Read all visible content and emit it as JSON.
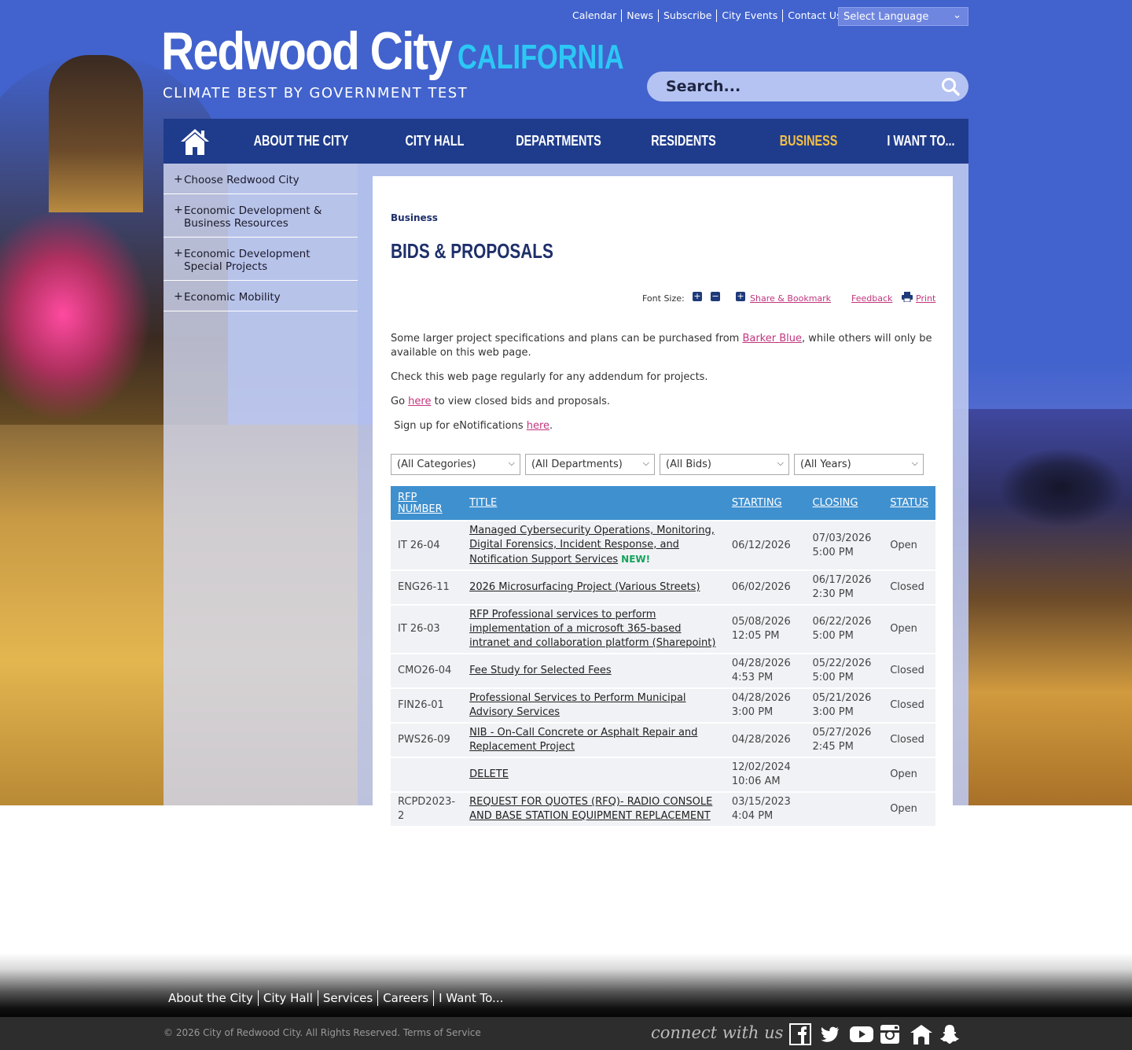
{
  "utility_links": [
    "Calendar",
    "News",
    "Subscribe",
    "City Events",
    "Contact Us"
  ],
  "language_select": "Select Language",
  "logo": {
    "name": "Redwood City",
    "state": "CALIFORNIA",
    "tagline": "CLIMATE BEST BY GOVERNMENT TEST"
  },
  "search": {
    "placeholder": "Search..."
  },
  "nav": {
    "items": [
      "ABOUT THE CITY",
      "CITY HALL",
      "DEPARTMENTS",
      "RESIDENTS",
      "BUSINESS",
      "I WANT TO..."
    ],
    "active": "BUSINESS"
  },
  "sidebar": {
    "items": [
      "Choose Redwood City",
      "Economic Development & Business Resources",
      "Economic Development Special Projects",
      "Economic Mobility"
    ]
  },
  "page": {
    "breadcrumb": "Business",
    "title": "BIDS & PROPOSALS",
    "tools": {
      "font_size": "Font Size:",
      "share": "Share & Bookmark",
      "feedback": "Feedback",
      "print": "Print"
    },
    "intro1_a": "Some larger project specifications and plans can be purchased from ",
    "intro1_link": "Barker Blue",
    "intro1_b": ", while others will only be available on this web page.",
    "intro2": "Check this web page regularly for any addendum for projects.",
    "intro3_a": "Go ",
    "intro3_link": "here",
    "intro3_b": " to view closed bids and proposals.",
    "intro4_a": " Sign up for eNotifications ",
    "intro4_link": "here",
    "intro4_b": "."
  },
  "filters": [
    "(All Categories)",
    "(All Departments)",
    "(All Bids)",
    "(All Years)"
  ],
  "table": {
    "headers": {
      "rfp": "RFP NUMBER",
      "title": "TITLE",
      "starting": "STARTING",
      "closing": "CLOSING",
      "status": "STATUS"
    },
    "rows": [
      {
        "rfp": "IT 26-04",
        "title": "Managed Cybersecurity Operations, Monitoring, Digital Forensics, Incident Response, and Notification Support Services",
        "new": "NEW!",
        "start_date": "06/12/2026",
        "start_time": "",
        "close_date": "07/03/2026",
        "close_time": "5:00 PM",
        "status": "Open"
      },
      {
        "rfp": "ENG26-11",
        "title": "2026 Microsurfacing Project (Various Streets)",
        "new": "",
        "start_date": "06/02/2026",
        "start_time": "",
        "close_date": "06/17/2026",
        "close_time": "2:30 PM",
        "status": "Closed"
      },
      {
        "rfp": "IT 26-03",
        "title": "RFP  Professional services to perform implementation of a microsoft 365-based intranet and collaboration platform (Sharepoint)",
        "new": "",
        "start_date": "05/08/2026",
        "start_time": "12:05 PM",
        "close_date": "06/22/2026",
        "close_time": "5:00 PM",
        "status": "Open"
      },
      {
        "rfp": "CMO26-04",
        "title": "Fee Study for Selected Fees",
        "new": "",
        "start_date": "04/28/2026",
        "start_time": "4:53 PM",
        "close_date": "05/22/2026",
        "close_time": "5:00 PM",
        "status": "Closed"
      },
      {
        "rfp": "FIN26-01",
        "title": "Professional Services to Perform Municipal Advisory Services",
        "new": "",
        "start_date": "04/28/2026",
        "start_time": "3:00 PM",
        "close_date": "05/21/2026",
        "close_time": "3:00 PM",
        "status": "Closed"
      },
      {
        "rfp": "PWS26-09",
        "title": "NIB - On-Call Concrete or Asphalt Repair and Replacement Project",
        "new": "",
        "start_date": "04/28/2026",
        "start_time": "",
        "close_date": "05/27/2026",
        "close_time": "2:45 PM",
        "status": "Closed"
      },
      {
        "rfp": "",
        "title": "DELETE",
        "new": "",
        "start_date": "12/02/2024",
        "start_time": "10:06 AM",
        "close_date": "",
        "close_time": "",
        "status": "Open"
      },
      {
        "rfp": "RCPD2023-2",
        "title": "REQUEST FOR QUOTES (RFQ)- RADIO CONSOLE AND BASE STATION EQUIPMENT REPLACEMENT",
        "new": "",
        "start_date": "03/15/2023",
        "start_time": "4:04 PM",
        "close_date": "",
        "close_time": "",
        "status": "Open"
      }
    ]
  },
  "footer": {
    "links": [
      "About the City",
      "City Hall",
      "Services",
      "Careers",
      "I Want To..."
    ],
    "copyright": "© 2026 City of Redwood City. All Rights Reserved. Terms of Service",
    "connect": "connect with us",
    "social": [
      "facebook-icon",
      "twitter-icon",
      "youtube-icon",
      "instagram-icon",
      "nextdoor-icon",
      "snapchat-icon"
    ]
  },
  "colors": {
    "brand_blue": "#4263cd",
    "nav_blue": "#1f3c8c",
    "accent_gold": "#f5c042",
    "logo_cyan": "#2cc8f5",
    "table_header": "#3f90cf",
    "link_pink": "#c2357e"
  }
}
